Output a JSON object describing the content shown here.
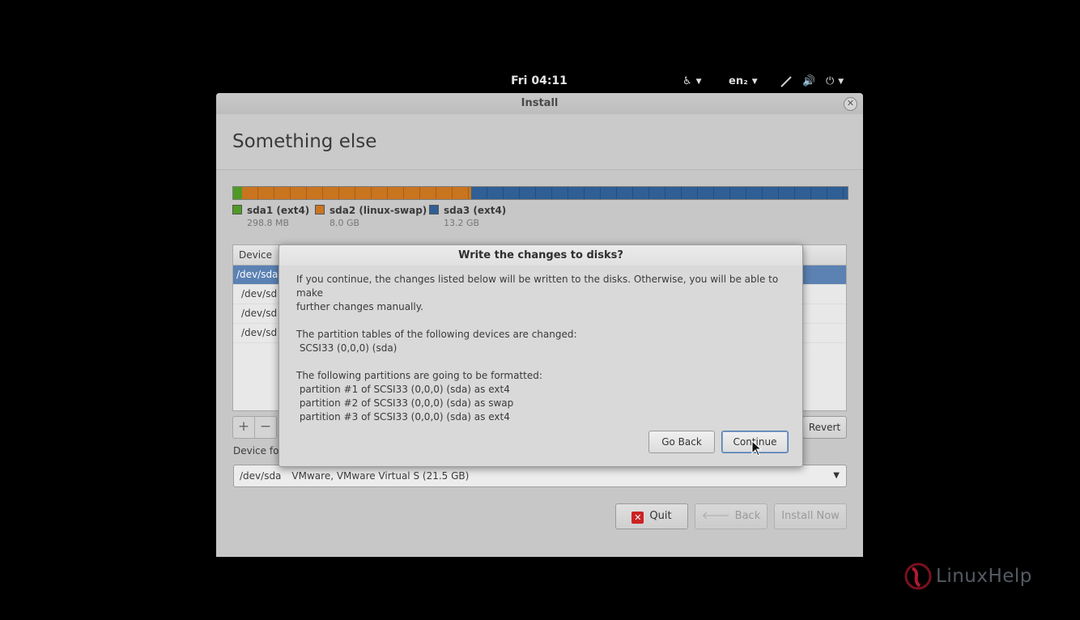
{
  "top_panel": {
    "clock": "Fri 04:11",
    "accessibility_icon": "accessibility-icon",
    "language": "en₂",
    "network_icon": "network-icon",
    "volume_icon": "volume-icon",
    "power_icon": "power-icon"
  },
  "window": {
    "title": "Install",
    "page_title": "Something else",
    "partitions": [
      {
        "name": "sda1 (ext4)",
        "size": "298.8 MB",
        "color": "#4e9a24",
        "fraction": 0.014
      },
      {
        "name": "sda2 (linux-swap)",
        "size": "8.0 GB",
        "color": "#c9741f",
        "fraction": 0.373
      },
      {
        "name": "sda3 (ext4)",
        "size": "13.2 GB",
        "color": "#2f5f95",
        "fraction": 0.613
      }
    ],
    "table": {
      "header": "Device",
      "rows": [
        "/dev/sda",
        "/dev/sd",
        "/dev/sd",
        "/dev/sd"
      ]
    },
    "add_label": "+",
    "remove_label": "−",
    "revert_label": "Revert",
    "boot_label": "Device for",
    "boot_device": "/dev/sda",
    "boot_device_desc": "VMware, VMware Virtual S (21.5 GB)",
    "quit_label": "Quit",
    "back_label": "Back",
    "install_label": "Install Now"
  },
  "dialog": {
    "title": "Write the changes to disks?",
    "intro_line1": "If you continue, the changes listed below will be written to the disks. Otherwise, you will be able to make",
    "intro_line2": "further changes manually.",
    "tables_heading": "The partition tables of the following devices are changed:",
    "tables_item": " SCSI33 (0,0,0) (sda)",
    "format_heading": "The following partitions are going to be formatted:",
    "format_items": [
      " partition #1 of SCSI33 (0,0,0) (sda) as ext4",
      " partition #2 of SCSI33 (0,0,0) (sda) as swap",
      " partition #3 of SCSI33 (0,0,0) (sda) as ext4"
    ],
    "go_back_label": "Go Back",
    "continue_label": "Continue"
  },
  "watermark": {
    "text": "LinuxHelp"
  }
}
